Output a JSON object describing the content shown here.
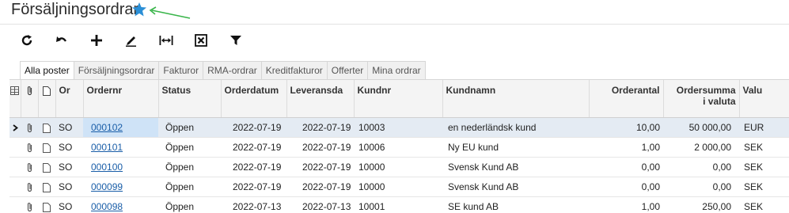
{
  "header": {
    "title": "Försäljningsordrar"
  },
  "colors": {
    "star": "#2b8fd6",
    "arrow": "#39b54a",
    "link": "#1a5ea8",
    "selected_row": "#e4ebf3"
  },
  "toolbar": {
    "buttons": [
      "refresh-icon",
      "undo-icon",
      "add-icon",
      "edit-icon",
      "fit-columns-icon",
      "export-excel-icon",
      "filter-icon"
    ]
  },
  "tabs": [
    {
      "label": "Alla poster",
      "active": true
    },
    {
      "label": "Försäljningsordrar",
      "active": false
    },
    {
      "label": "Fakturor",
      "active": false
    },
    {
      "label": "RMA-ordrar",
      "active": false
    },
    {
      "label": "Kreditfakturor",
      "active": false
    },
    {
      "label": "Offerter",
      "active": false
    },
    {
      "label": "Mina ordrar",
      "active": false
    }
  ],
  "table": {
    "columns": {
      "ordertyp": "Or",
      "ordernr": "Ordernr",
      "status": "Status",
      "orderdatum": "Orderdatum",
      "leveransdatum": "Leveransda",
      "kundnr": "Kundnr",
      "kundnamn": "Kundnamn",
      "orderantal": "Orderantal",
      "ordersumma_line1": "Ordersumma",
      "ordersumma_line2": "i valuta",
      "valuta": "Valu"
    },
    "rows": [
      {
        "typ": "SO",
        "ordernr": "000102",
        "status": "Öppen",
        "orderdatum": "2022-07-19",
        "leveransdatum": "2022-07-19",
        "kundnr": "10003",
        "kundnamn": "en nederländsk kund",
        "orderantal": "10,00",
        "ordersumma": "50 000,00",
        "valuta": "EUR",
        "selected": true
      },
      {
        "typ": "SO",
        "ordernr": "000101",
        "status": "Öppen",
        "orderdatum": "2022-07-19",
        "leveransdatum": "2022-07-19",
        "kundnr": "10006",
        "kundnamn": "Ny EU kund",
        "orderantal": "1,00",
        "ordersumma": "2 000,00",
        "valuta": "SEK",
        "selected": false
      },
      {
        "typ": "SO",
        "ordernr": "000100",
        "status": "Öppen",
        "orderdatum": "2022-07-19",
        "leveransdatum": "2022-07-19",
        "kundnr": "10000",
        "kundnamn": "Svensk Kund AB",
        "orderantal": "0,00",
        "ordersumma": "0,00",
        "valuta": "SEK",
        "selected": false
      },
      {
        "typ": "SO",
        "ordernr": "000099",
        "status": "Öppen",
        "orderdatum": "2022-07-19",
        "leveransdatum": "2022-07-19",
        "kundnr": "10000",
        "kundnamn": "Svensk Kund AB",
        "orderantal": "0,00",
        "ordersumma": "0,00",
        "valuta": "SEK",
        "selected": false
      },
      {
        "typ": "SO",
        "ordernr": "000098",
        "status": "Öppen",
        "orderdatum": "2022-07-13",
        "leveransdatum": "2022-07-13",
        "kundnr": "10001",
        "kundnamn": "SE kund AB",
        "orderantal": "1,00",
        "ordersumma": "250,00",
        "valuta": "SEK",
        "selected": false
      }
    ]
  }
}
